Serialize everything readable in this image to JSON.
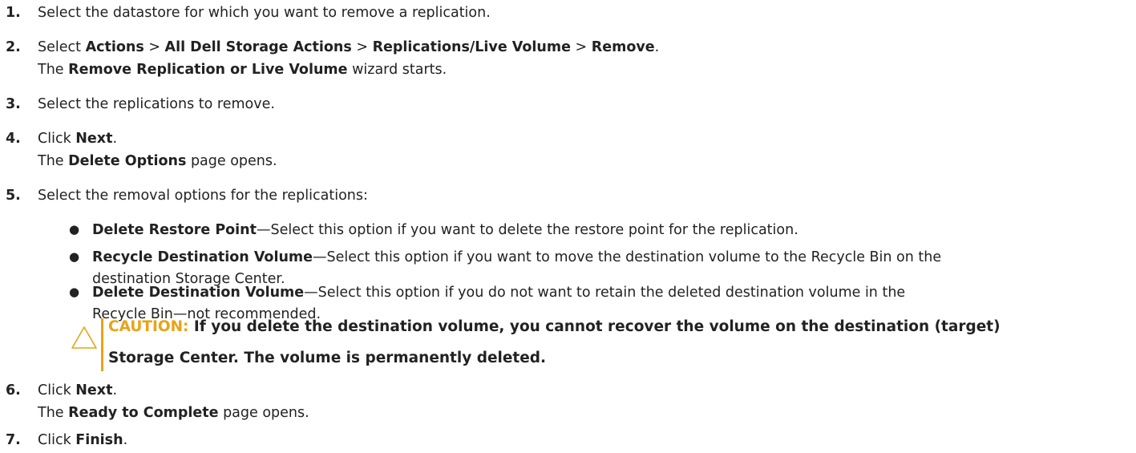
{
  "steps": [
    {
      "num": "1.",
      "line1": "Select the datastore for which you want to remove a replication."
    },
    {
      "num": "2.",
      "pre": "Select ",
      "a1": "Actions",
      "sep1": " > ",
      "a2": "All Dell Storage Actions",
      "sep2": " > ",
      "a3": "Replications/Live Volume",
      "sep3": " > ",
      "a4": "Remove",
      "post": ".",
      "l2pre": "The ",
      "l2bold": "Remove Replication or Live Volume",
      "l2post": " wizard starts."
    },
    {
      "num": "3.",
      "line1": "Select the replications to remove."
    },
    {
      "num": "4.",
      "pre": "Click ",
      "bold": "Next",
      "post": ".",
      "l2pre": "The ",
      "l2bold": "Delete Options",
      "l2post": " page opens."
    },
    {
      "num": "5.",
      "line1": "Select the removal options for the replications:"
    },
    {
      "num": "6.",
      "pre": "Click ",
      "bold": "Next",
      "post": ".",
      "l2pre": "The ",
      "l2bold": "Ready to Complete",
      "l2post": " page opens."
    },
    {
      "num": "7.",
      "pre": "Click ",
      "bold": "Finish",
      "post": "."
    }
  ],
  "options": [
    {
      "term": "Delete Restore Point",
      "desc": "—Select this option if you want to delete the restore point for the replication."
    },
    {
      "term": "Recycle Destination Volume",
      "desc": "—Select this option if you want to move the destination volume to the Recycle Bin on the",
      "desc2": "destination Storage Center."
    },
    {
      "term": "Delete Destination Volume",
      "desc": "—Select this option if you do not want to retain the deleted destination volume in the",
      "desc2": "Recycle Bin—not recommended."
    }
  ],
  "bullet_glyph": "●",
  "caution": {
    "label": "CAUTION:",
    "line1": " If you delete the destination volume, you cannot recover the volume on the destination (target)",
    "line2": "Storage Center. The volume is permanently deleted.",
    "color": "#e8a317",
    "icon": "warning-triangle-icon"
  }
}
